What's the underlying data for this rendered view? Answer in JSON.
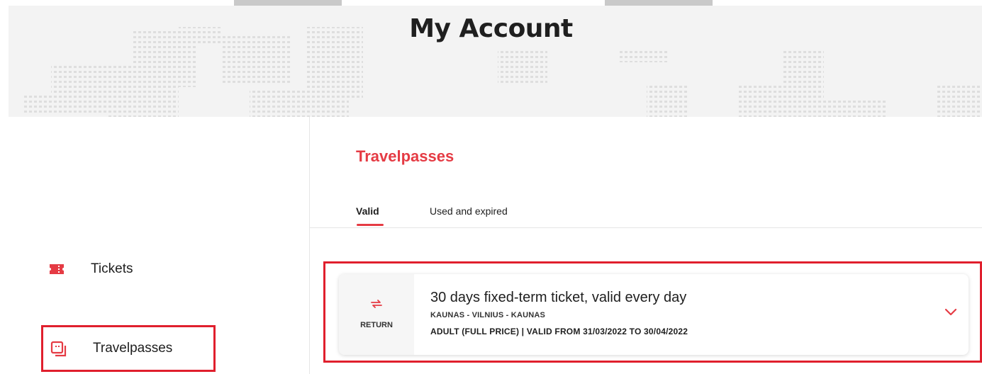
{
  "header": {
    "title": "My Account"
  },
  "sidebar": {
    "items": [
      {
        "label": "Tickets",
        "icon": "ticket-icon"
      },
      {
        "label": "Travelpasses",
        "icon": "travelpass-icon",
        "selected": true
      }
    ]
  },
  "main": {
    "section_title": "Travelpasses",
    "tabs": [
      {
        "label": "Valid",
        "active": true
      },
      {
        "label": "Used and expired",
        "active": false
      }
    ],
    "pass": {
      "trip_type": "RETURN",
      "trip_icon": "return-arrows-icon",
      "title": "30 days fixed-term ticket, valid every day",
      "route": "KAUNAS - VILNIUS - KAUNAS",
      "details": "ADULT (FULL PRICE) | VALID FROM 31/03/2022 TO 30/04/2022",
      "expand_icon": "chevron-down-icon"
    }
  },
  "colors": {
    "accent": "#e53b44",
    "highlight": "#e01f2d",
    "hero_bg": "#f3f3f3"
  }
}
